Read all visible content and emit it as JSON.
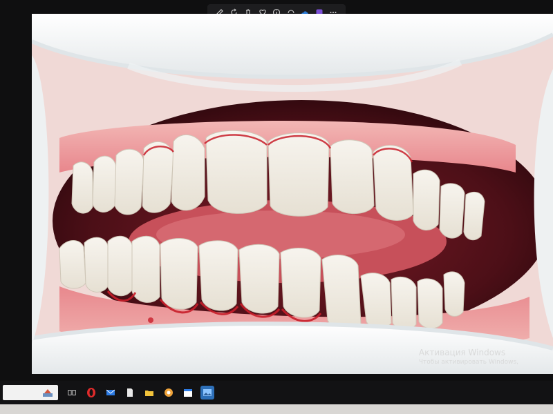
{
  "photo_viewer": {
    "toolbar": [
      {
        "name": "edit-icon",
        "tooltip": ""
      },
      {
        "name": "rotate-icon",
        "tooltip": ""
      },
      {
        "name": "delete-icon",
        "tooltip": ""
      },
      {
        "name": "favorite-icon",
        "tooltip": ""
      },
      {
        "name": "info-icon",
        "tooltip": ""
      },
      {
        "name": "share-icon",
        "tooltip": ""
      },
      {
        "name": "onedrive-icon",
        "tooltip": ""
      },
      {
        "name": "clipchamp-icon",
        "tooltip": ""
      },
      {
        "name": "more-icon",
        "tooltip": ""
      }
    ]
  },
  "watermark": {
    "title": "Активация Windows",
    "subtitle": "Чтобы активировать Windows,"
  },
  "taskbar": {
    "icons": [
      "task-view-icon",
      "opera-icon",
      "mail-icon",
      "file-icon",
      "file-explorer-icon",
      "photo-app-icon",
      "calendar-icon",
      "photos-icon"
    ],
    "active": "photos-icon"
  },
  "colors": {
    "gum": "#e67f86",
    "blood": "#c81e2a",
    "teeth": "#f4f1ea",
    "retractor": "#f2f4f5",
    "taskbar": "#121214",
    "active_icon": "#2d6fb8"
  }
}
